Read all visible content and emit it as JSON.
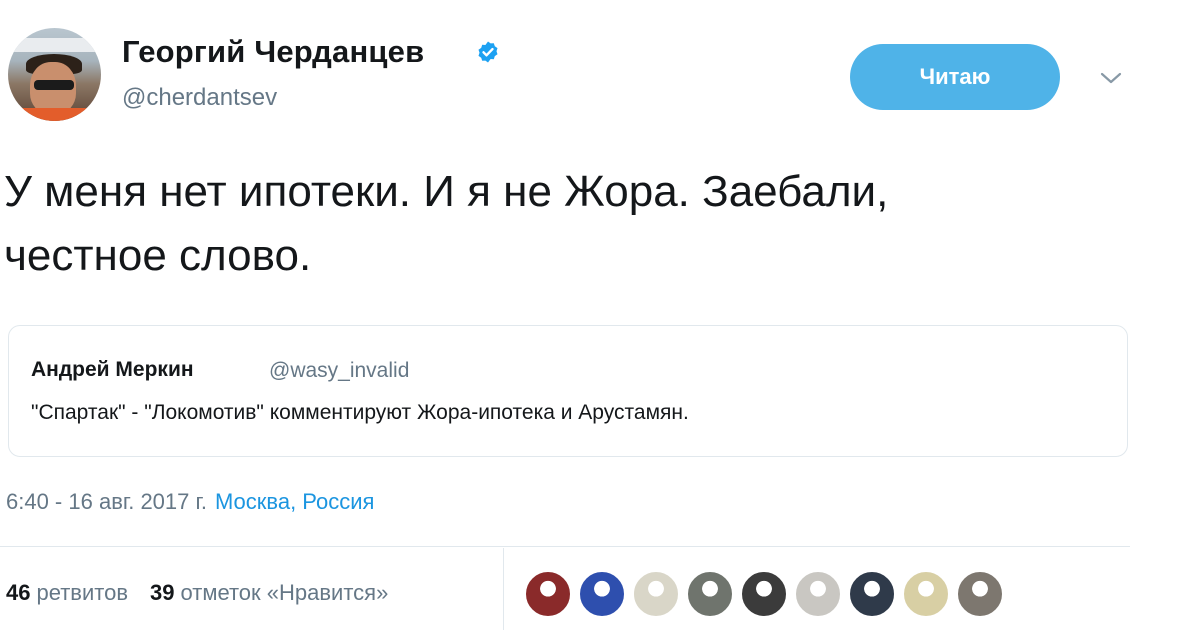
{
  "author": {
    "name": "Георгий Черданцев",
    "handle": "@cherdantsev",
    "verified": true,
    "avatar_icon": "profile-photo-avatar"
  },
  "actions": {
    "follow_label": "Читаю",
    "menu_icon": "chevron-down-icon"
  },
  "tweet": {
    "line1": "У меня нет ипотеки. И я не Жора. Заебали,",
    "line2": "честное слово."
  },
  "quote": {
    "name": "Андрей Меркин",
    "handle": "@wasy_invalid",
    "text": "\"Спартак\" - \"Локомотив\" комментируют Жора-ипотека и Арустамян."
  },
  "meta": {
    "time": "6:40 - 16 авг. 2017 г.",
    "location": "Москва, Россия"
  },
  "stats": {
    "retweets_count": "46",
    "retweets_label": "ретвитов",
    "likes_count": "39",
    "likes_label": "отметок «Нравится»"
  },
  "likers": [
    {
      "icon": "liker-avatar",
      "color": "#8a2a2a"
    },
    {
      "icon": "liker-avatar",
      "color": "#2e4fae"
    },
    {
      "icon": "liker-avatar",
      "color": "#d9d6c8"
    },
    {
      "icon": "liker-avatar",
      "color": "#6f746d"
    },
    {
      "icon": "liker-avatar",
      "color": "#3b3b3b"
    },
    {
      "icon": "liker-avatar",
      "color": "#c9c7c2"
    },
    {
      "icon": "liker-avatar",
      "color": "#2f3a4a"
    },
    {
      "icon": "liker-avatar",
      "color": "#d8cfa4"
    },
    {
      "icon": "liker-avatar",
      "color": "#7d776f"
    }
  ],
  "colors": {
    "accent": "#1b95e0",
    "follow_button": "#4fb3e8",
    "muted": "#657786",
    "border": "#e1e8ed"
  }
}
